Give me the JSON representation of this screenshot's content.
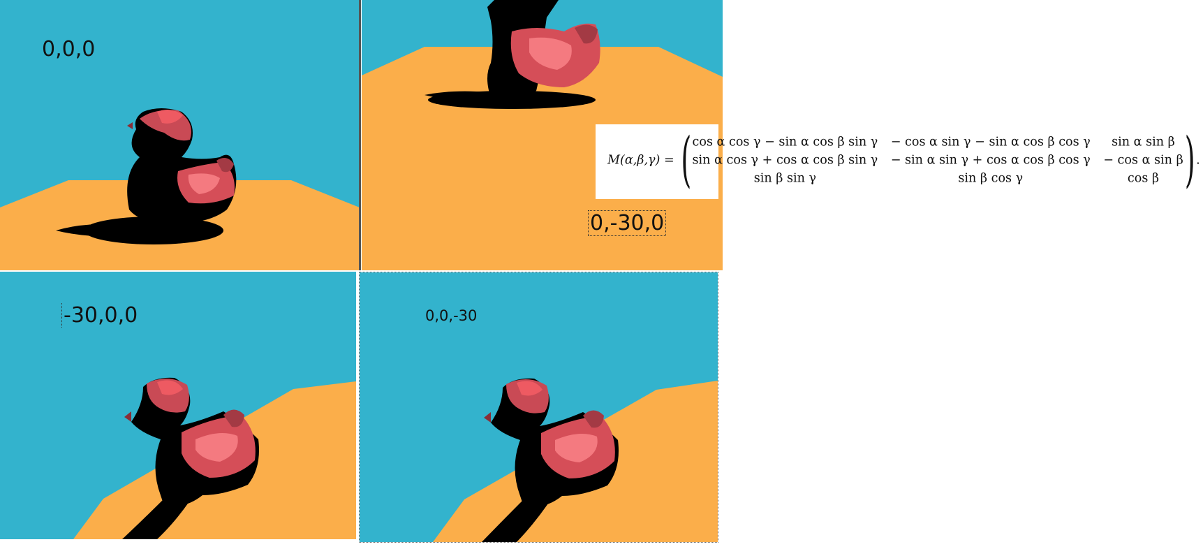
{
  "panels": [
    {
      "label": "0,0,0"
    },
    {
      "label": "0,-30,0"
    },
    {
      "label": "-30,0,0"
    },
    {
      "label": "0,0,-30"
    }
  ],
  "formula": {
    "lhs": "M(α,β,γ) =",
    "trailing": ".",
    "rows": [
      [
        "cos α cos γ − sin α cos β sin γ",
        "− cos α sin γ − sin α cos β cos γ",
        "sin α sin β"
      ],
      [
        "sin α cos γ + cos α cos β sin γ",
        "− sin α sin γ + cos α cos β cos γ",
        "− cos α sin β"
      ],
      [
        "sin β sin γ",
        "sin β cos γ",
        "cos β"
      ]
    ]
  },
  "colors": {
    "sky": "#33b3cd",
    "floor": "#fbae4a",
    "duck": "#ee5a62",
    "shadow": "#000000"
  }
}
